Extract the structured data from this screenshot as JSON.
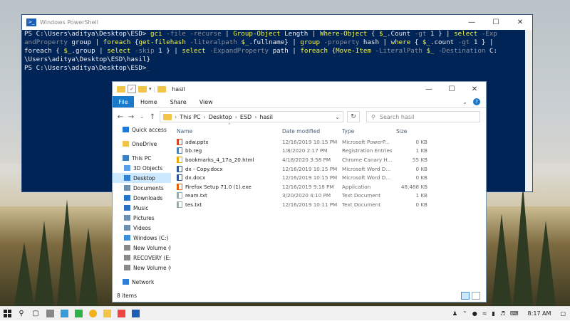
{
  "powershell": {
    "title": "Windows PowerShell",
    "lines": [
      [
        [
          "w",
          "PS C:\\Users\\aditya\\Desktop\\ESD> "
        ],
        [
          "y",
          "gci "
        ],
        [
          "g",
          "-file -recurse "
        ],
        [
          "w",
          "| "
        ],
        [
          "y",
          "Group-Object "
        ],
        [
          "w",
          "Length | "
        ],
        [
          "y",
          "Where-Object "
        ],
        [
          "w",
          "{ "
        ],
        [
          "y",
          "$_"
        ],
        [
          "w",
          ".Count "
        ],
        [
          "g",
          "-gt "
        ],
        [
          "w",
          "1 } | "
        ],
        [
          "y",
          "select "
        ],
        [
          "g",
          "-Exp"
        ]
      ],
      [
        [
          "g",
          "andProperty "
        ],
        [
          "w",
          "group | "
        ],
        [
          "y",
          "foreach "
        ],
        [
          "w",
          "{"
        ],
        [
          "y",
          "get-filehash "
        ],
        [
          "g",
          "-literalpath "
        ],
        [
          "y",
          "$_"
        ],
        [
          "w",
          ".fullname} | "
        ],
        [
          "y",
          "group "
        ],
        [
          "g",
          "-property "
        ],
        [
          "w",
          "hash | "
        ],
        [
          "y",
          "where "
        ],
        [
          "w",
          "{ "
        ],
        [
          "y",
          "$_"
        ],
        [
          "w",
          ".count "
        ],
        [
          "g",
          "-gt "
        ],
        [
          "w",
          "1 } |"
        ]
      ],
      [
        [
          "w",
          "foreach { "
        ],
        [
          "y",
          "$_"
        ],
        [
          "w",
          ".group | "
        ],
        [
          "y",
          "select "
        ],
        [
          "g",
          "-skip "
        ],
        [
          "w",
          "1 } | "
        ],
        [
          "y",
          "select "
        ],
        [
          "g",
          "-ExpandProperty "
        ],
        [
          "w",
          "path | "
        ],
        [
          "y",
          "foreach "
        ],
        [
          "w",
          "{"
        ],
        [
          "y",
          "Move-Item "
        ],
        [
          "g",
          "-LiteralPath "
        ],
        [
          "y",
          "$_ "
        ],
        [
          "g",
          "-Destination "
        ],
        [
          "w",
          "C:"
        ]
      ],
      [
        [
          "w",
          "\\Users\\aditya\\Desktop\\ESD\\hasil}"
        ]
      ],
      [
        [
          "w",
          "PS C:\\Users\\aditya\\Desktop\\ESD>"
        ],
        [
          "gr",
          "_"
        ]
      ]
    ]
  },
  "explorer": {
    "title": "hasil",
    "ribbon_tabs": [
      "File",
      "Home",
      "Share",
      "View"
    ],
    "breadcrumb": [
      "This PC",
      "Desktop",
      "ESD",
      "hasil"
    ],
    "search_placeholder": "Search hasil",
    "sidebar": [
      {
        "label": "Quick access",
        "icon": "star-icon",
        "color": "#1e78d7"
      },
      {
        "label": "OneDrive",
        "icon": "cloud-icon",
        "color": "#f3c44a"
      },
      {
        "label": "This PC",
        "icon": "computer-icon",
        "color": "#3b7fc4"
      },
      {
        "label": "3D Objects",
        "icon": "cube-icon",
        "color": "#5aa0e6"
      },
      {
        "label": "Desktop",
        "icon": "desktop-icon",
        "color": "#2f7fd6",
        "selected": true
      },
      {
        "label": "Documents",
        "icon": "document-icon",
        "color": "#6c8fb0"
      },
      {
        "label": "Downloads",
        "icon": "download-icon",
        "color": "#2277cc"
      },
      {
        "label": "Music",
        "icon": "music-icon",
        "color": "#2a6fbf"
      },
      {
        "label": "Pictures",
        "icon": "picture-icon",
        "color": "#6c8fb0"
      },
      {
        "label": "Videos",
        "icon": "video-icon",
        "color": "#6c8fb0"
      },
      {
        "label": "Windows (C:)",
        "icon": "drive-icon",
        "color": "#3a8fd8"
      },
      {
        "label": "New Volume (D:",
        "icon": "drive-icon",
        "color": "#888888"
      },
      {
        "label": "RECOVERY (E:)",
        "icon": "drive-icon",
        "color": "#888888"
      },
      {
        "label": "New Volume (G:",
        "icon": "drive-icon",
        "color": "#888888"
      },
      {
        "label": "Network",
        "icon": "network-icon",
        "color": "#2f7fd6"
      }
    ],
    "columns": [
      "Name",
      "Date modified",
      "Type",
      "Size"
    ],
    "files": [
      {
        "name": "adw.pptx",
        "date": "12/16/2019 10:15 PM",
        "type": "Microsoft PowerP...",
        "size": "0 KB",
        "color": "#d24726"
      },
      {
        "name": "bb.reg",
        "date": "1/8/2020 2:17 PM",
        "type": "Registration Entries",
        "size": "1 KB",
        "color": "#4a7fb5"
      },
      {
        "name": "bookmarks_4_17a_20.html",
        "date": "4/18/2020 3:58 PM",
        "type": "Chrome Canary H...",
        "size": "55 KB",
        "color": "#e8a800"
      },
      {
        "name": "dx - Copy.docx",
        "date": "12/16/2019 10:15 PM",
        "type": "Microsoft Word D...",
        "size": "0 KB",
        "color": "#2b579a"
      },
      {
        "name": "dx.docx",
        "date": "12/16/2019 10:15 PM",
        "type": "Microsoft Word D...",
        "size": "0 KB",
        "color": "#2b579a"
      },
      {
        "name": "Firefox Setup 71.0 (1).exe",
        "date": "12/16/2019 9:18 PM",
        "type": "Application",
        "size": "48,488 KB",
        "color": "#e66000"
      },
      {
        "name": "ream.txt",
        "date": "3/20/2020 4:10 PM",
        "type": "Text Document",
        "size": "1 KB",
        "color": "#9aa"
      },
      {
        "name": "tes.txt",
        "date": "12/16/2019 10:11 PM",
        "type": "Text Document",
        "size": "0 KB",
        "color": "#9aa"
      }
    ],
    "status": "8 items"
  },
  "taskbar": {
    "time": "8:17 AM"
  }
}
